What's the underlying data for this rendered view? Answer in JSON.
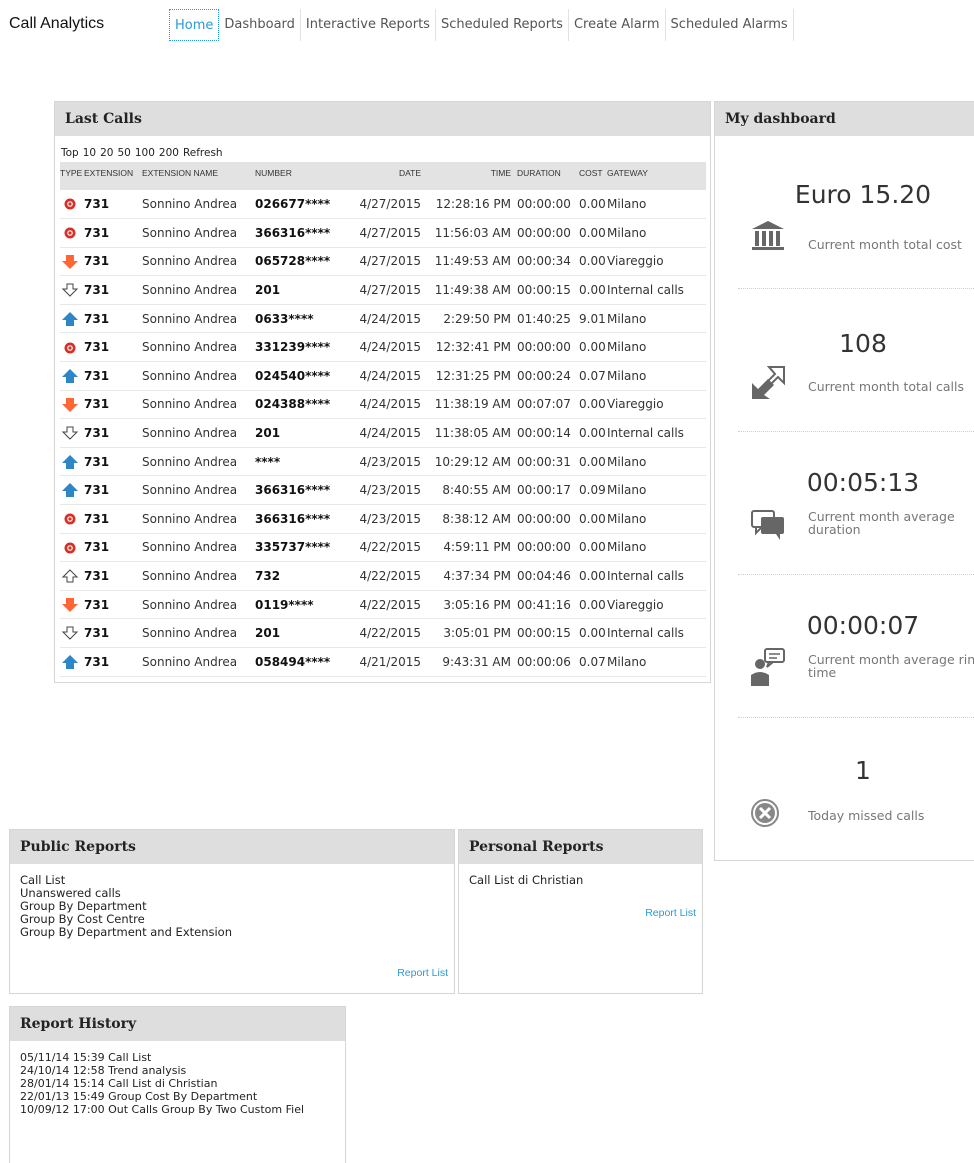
{
  "app": {
    "title": "Call Analytics"
  },
  "nav": {
    "items": [
      "Home",
      "Dashboard",
      "Interactive Reports",
      "Scheduled Reports",
      "Create Alarm",
      "Scheduled Alarms"
    ],
    "active": "Home"
  },
  "last_calls": {
    "title": "Last Calls",
    "top_label": "Top",
    "top_options": [
      "10",
      "20",
      "50",
      "100",
      "200"
    ],
    "refresh_label": "Refresh",
    "columns": [
      "TYPE",
      "EXTENSION",
      "EXTENSION NAME",
      "NUMBER",
      "DATE",
      "TIME",
      "DURATION",
      "COST",
      "GATEWAY"
    ],
    "type_colors": {
      "missed": "#d93025",
      "out_external": "#ff6633",
      "internal": "#ffffff",
      "in_external": "#2f86c6"
    },
    "rows": [
      {
        "type": "missed-call-icon",
        "extension": "731",
        "name": "Sonnino Andrea",
        "number": "026677****",
        "date": "4/27/2015",
        "time": "12:28:16 PM",
        "duration": "00:00:00",
        "cost": "0.00",
        "gateway": "Milano"
      },
      {
        "type": "missed-call-icon",
        "extension": "731",
        "name": "Sonnino Andrea",
        "number": "366316****",
        "date": "4/27/2015",
        "time": "11:56:03 AM",
        "duration": "00:00:00",
        "cost": "0.00",
        "gateway": "Milano"
      },
      {
        "type": "outgoing-call-icon",
        "extension": "731",
        "name": "Sonnino Andrea",
        "number": "065728****",
        "date": "4/27/2015",
        "time": "11:49:53 AM",
        "duration": "00:00:34",
        "cost": "0.00",
        "gateway": "Viareggio"
      },
      {
        "type": "internal-down-icon",
        "extension": "731",
        "name": "Sonnino Andrea",
        "number": "201",
        "date": "4/27/2015",
        "time": "11:49:38 AM",
        "duration": "00:00:15",
        "cost": "0.00",
        "gateway": "Internal calls"
      },
      {
        "type": "incoming-call-icon",
        "extension": "731",
        "name": "Sonnino Andrea",
        "number": "0633****",
        "date": "4/24/2015",
        "time": "2:29:50 PM",
        "duration": "01:40:25",
        "cost": "9.01",
        "gateway": "Milano"
      },
      {
        "type": "missed-call-icon",
        "extension": "731",
        "name": "Sonnino Andrea",
        "number": "331239****",
        "date": "4/24/2015",
        "time": "12:32:41 PM",
        "duration": "00:00:00",
        "cost": "0.00",
        "gateway": "Milano"
      },
      {
        "type": "incoming-call-icon",
        "extension": "731",
        "name": "Sonnino Andrea",
        "number": "024540****",
        "date": "4/24/2015",
        "time": "12:31:25 PM",
        "duration": "00:00:24",
        "cost": "0.07",
        "gateway": "Milano"
      },
      {
        "type": "outgoing-call-icon",
        "extension": "731",
        "name": "Sonnino Andrea",
        "number": "024388****",
        "date": "4/24/2015",
        "time": "11:38:19 AM",
        "duration": "00:07:07",
        "cost": "0.00",
        "gateway": "Viareggio"
      },
      {
        "type": "internal-down-icon",
        "extension": "731",
        "name": "Sonnino Andrea",
        "number": "201",
        "date": "4/24/2015",
        "time": "11:38:05 AM",
        "duration": "00:00:14",
        "cost": "0.00",
        "gateway": "Internal calls"
      },
      {
        "type": "incoming-call-icon",
        "extension": "731",
        "name": "Sonnino Andrea",
        "number": "****",
        "date": "4/23/2015",
        "time": "10:29:12 AM",
        "duration": "00:00:31",
        "cost": "0.00",
        "gateway": "Milano"
      },
      {
        "type": "incoming-call-icon",
        "extension": "731",
        "name": "Sonnino Andrea",
        "number": "366316****",
        "date": "4/23/2015",
        "time": "8:40:55 AM",
        "duration": "00:00:17",
        "cost": "0.09",
        "gateway": "Milano"
      },
      {
        "type": "missed-call-icon",
        "extension": "731",
        "name": "Sonnino Andrea",
        "number": "366316****",
        "date": "4/23/2015",
        "time": "8:38:12 AM",
        "duration": "00:00:00",
        "cost": "0.00",
        "gateway": "Milano"
      },
      {
        "type": "missed-call-icon",
        "extension": "731",
        "name": "Sonnino Andrea",
        "number": "335737****",
        "date": "4/22/2015",
        "time": "4:59:11 PM",
        "duration": "00:00:00",
        "cost": "0.00",
        "gateway": "Milano"
      },
      {
        "type": "internal-up-icon",
        "extension": "731",
        "name": "Sonnino Andrea",
        "number": "732",
        "date": "4/22/2015",
        "time": "4:37:34 PM",
        "duration": "00:04:46",
        "cost": "0.00",
        "gateway": "Internal calls"
      },
      {
        "type": "outgoing-call-icon",
        "extension": "731",
        "name": "Sonnino Andrea",
        "number": "0119****",
        "date": "4/22/2015",
        "time": "3:05:16 PM",
        "duration": "00:41:16",
        "cost": "0.00",
        "gateway": "Viareggio"
      },
      {
        "type": "internal-down-icon",
        "extension": "731",
        "name": "Sonnino Andrea",
        "number": "201",
        "date": "4/22/2015",
        "time": "3:05:01 PM",
        "duration": "00:00:15",
        "cost": "0.00",
        "gateway": "Internal calls"
      },
      {
        "type": "incoming-call-icon",
        "extension": "731",
        "name": "Sonnino Andrea",
        "number": "058494****",
        "date": "4/21/2015",
        "time": "9:43:31 AM",
        "duration": "00:00:06",
        "cost": "0.07",
        "gateway": "Milano"
      }
    ]
  },
  "dashboard": {
    "title": "My dashboard",
    "stats": [
      {
        "value": "Euro 15.20",
        "label": "Current month total cost",
        "icon": "bank-icon"
      },
      {
        "value": "108",
        "label": "Current month total calls",
        "icon": "call-arrows-icon"
      },
      {
        "value": "00:05:13",
        "label": "Current month average duration",
        "icon": "chat-bubbles-icon"
      },
      {
        "value": "00:00:07",
        "label": "Current month average ring time",
        "icon": "person-speech-icon"
      },
      {
        "value": "1",
        "label": "Today missed calls",
        "icon": "missed-circle-icon"
      }
    ]
  },
  "public_reports": {
    "title": "Public Reports",
    "items": [
      "Call List",
      "Unanswered calls",
      "Group By Department",
      "Group By Cost Centre",
      "Group By Department and Extension"
    ],
    "link": "Report List"
  },
  "personal_reports": {
    "title": "Personal Reports",
    "items": [
      "Call List di Christian"
    ],
    "link": "Report List"
  },
  "report_history": {
    "title": "Report History",
    "items": [
      {
        "date": "05/11/14 15:39",
        "name": "Call List"
      },
      {
        "date": "24/10/14 12:58",
        "name": "Trend analysis"
      },
      {
        "date": "28/01/14 15:14",
        "name": "Call List di Christian"
      },
      {
        "date": "22/01/13 15:49",
        "name": "Group Cost By Department"
      },
      {
        "date": "10/09/12 17:00",
        "name": "Out Calls Group By Two Custom Fiel"
      }
    ]
  }
}
